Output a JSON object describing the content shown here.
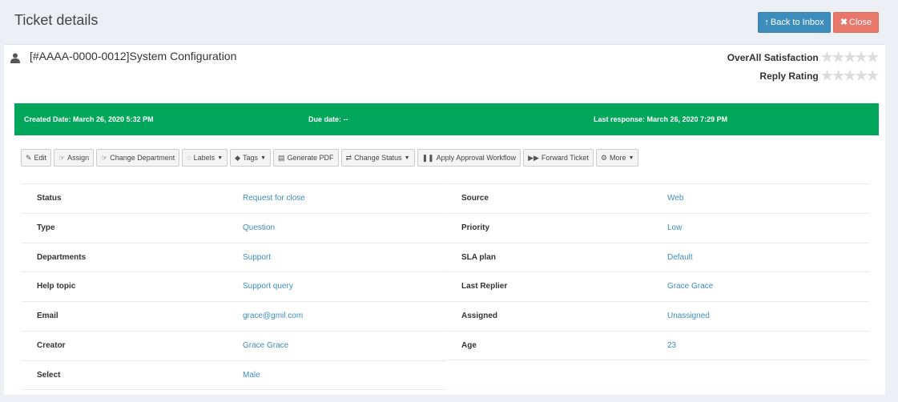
{
  "header": {
    "title": "Ticket details",
    "back_label": "Back to Inbox",
    "close_label": "Close"
  },
  "ticket": {
    "title": "[#AAAA-0000-0012]System Configuration",
    "overall_satisfaction_label": "OverAll Satisfaction",
    "reply_rating_label": "Reply Rating",
    "overall_satisfaction_stars": 0,
    "reply_rating_stars": 0,
    "max_stars": 5
  },
  "info_bar": {
    "created": "Created Date: March 26, 2020 5:32 PM",
    "due": "Due date: --",
    "last_response": "Last response: March 26, 2020 7:29 PM",
    "color": "#00a65a"
  },
  "toolbar": {
    "edit": "Edit",
    "assign": "Assign",
    "change_department": "Change Department",
    "labels": "Labels",
    "tags": "Tags",
    "generate_pdf": "Generate PDF",
    "change_status": "Change Status",
    "apply_approval": "Apply Approval Workflow",
    "forward": "Forward Ticket",
    "more": "More"
  },
  "details": {
    "left": [
      {
        "label": "Status",
        "value": "Request for close"
      },
      {
        "label": "Type",
        "value": "Question"
      },
      {
        "label": "Departments",
        "value": "Support"
      },
      {
        "label": "Help topic",
        "value": "Support query"
      },
      {
        "label": "Email",
        "value": "grace@gmil.com"
      },
      {
        "label": "Creator",
        "value": "Grace Grace"
      },
      {
        "label": "Select",
        "value": "Male"
      }
    ],
    "right": [
      {
        "label": "Source",
        "value": "Web"
      },
      {
        "label": "Priority",
        "value": "Low"
      },
      {
        "label": "SLA plan",
        "value": "Default"
      },
      {
        "label": "Last Replier",
        "value": "Grace Grace"
      },
      {
        "label": "Assigned",
        "value": "Unassigned"
      },
      {
        "label": "Age",
        "value": "23"
      }
    ]
  },
  "colors": {
    "primary": "#3c8dbc",
    "danger": "#e8786b",
    "success": "#00a65a"
  }
}
